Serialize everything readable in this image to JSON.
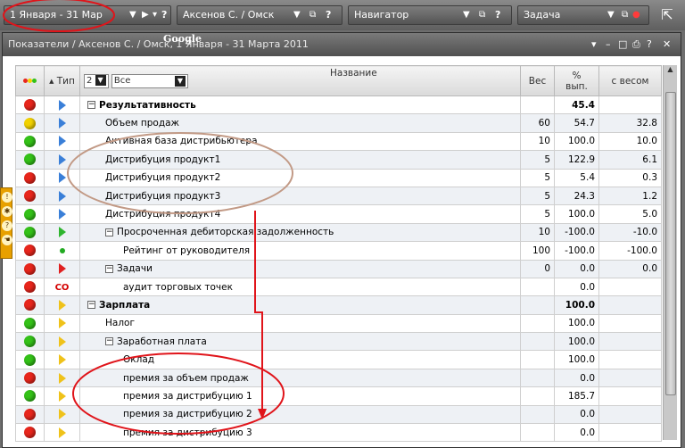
{
  "toolbar": {
    "period": "1 Января - 31 Мар",
    "user": "Аксенов С. / Омск",
    "navigator": "Навигатор",
    "task": "Задача"
  },
  "window": {
    "title": "Показатели / Аксенов С. / Омск, 1 Января - 31 Марта 2011",
    "google": "Google"
  },
  "columns": {
    "type": "Тип",
    "filter_num": "2",
    "filter_all": "Все",
    "name": "Название",
    "weight": "Вес",
    "pct_line1": "%",
    "pct_line2": "вып.",
    "weighted": "с весом"
  },
  "rows": [
    {
      "status": "red",
      "type": "tri-blue",
      "indent": 0,
      "expander": "⊟",
      "name": "Результативность",
      "bold": true,
      "weight": "",
      "pct": "45.4",
      "weighted": ""
    },
    {
      "status": "yellow",
      "type": "tri-blue",
      "indent": 1,
      "expander": "",
      "name": "Объем продаж",
      "bold": false,
      "weight": "60",
      "pct": "54.7",
      "weighted": "32.8"
    },
    {
      "status": "green",
      "type": "tri-blue",
      "indent": 1,
      "expander": "",
      "name": "Активная база дистрибьютера",
      "bold": false,
      "weight": "10",
      "pct": "100.0",
      "weighted": "10.0"
    },
    {
      "status": "green",
      "type": "tri-blue",
      "indent": 1,
      "expander": "",
      "name": "Дистрибуция продукт1",
      "bold": false,
      "weight": "5",
      "pct": "122.9",
      "weighted": "6.1"
    },
    {
      "status": "red",
      "type": "tri-blue",
      "indent": 1,
      "expander": "",
      "name": "Дистрибуция продукт2",
      "bold": false,
      "weight": "5",
      "pct": "5.4",
      "weighted": "0.3"
    },
    {
      "status": "red",
      "type": "tri-blue",
      "indent": 1,
      "expander": "",
      "name": "Дистрибуция продукт3",
      "bold": false,
      "weight": "5",
      "pct": "24.3",
      "weighted": "1.2"
    },
    {
      "status": "green",
      "type": "tri-blue",
      "indent": 1,
      "expander": "",
      "name": "Дистрибуция продукт4",
      "bold": false,
      "weight": "5",
      "pct": "100.0",
      "weighted": "5.0"
    },
    {
      "status": "green",
      "type": "tri-green",
      "indent": 1,
      "expander": "⊟",
      "name": "Просроченная дебиторская задолженность",
      "bold": false,
      "weight": "10",
      "pct": "-100.0",
      "weighted": "-10.0"
    },
    {
      "status": "red",
      "type": "dot-green",
      "indent": 2,
      "expander": "",
      "name": "Рейтинг от руководителя",
      "bold": false,
      "weight": "100",
      "pct": "-100.0",
      "weighted": "-100.0"
    },
    {
      "status": "red",
      "type": "tri-red",
      "indent": 1,
      "expander": "⊟",
      "name": "Задачи",
      "bold": false,
      "weight": "0",
      "pct": "0.0",
      "weighted": "0.0"
    },
    {
      "status": "red",
      "type": "co",
      "indent": 2,
      "expander": "",
      "name": "аудит торговых точек",
      "bold": false,
      "weight": "",
      "pct": "0.0",
      "weighted": ""
    },
    {
      "status": "red",
      "type": "tri-yellow",
      "indent": 0,
      "expander": "⊟",
      "name": "Зарплата",
      "bold": true,
      "weight": "",
      "pct": "100.0",
      "weighted": ""
    },
    {
      "status": "green",
      "type": "tri-yellow",
      "indent": 1,
      "expander": "",
      "name": "Налог",
      "bold": false,
      "weight": "",
      "pct": "100.0",
      "weighted": ""
    },
    {
      "status": "green",
      "type": "tri-yellow",
      "indent": 1,
      "expander": "⊟",
      "name": "Заработная плата",
      "bold": false,
      "weight": "",
      "pct": "100.0",
      "weighted": ""
    },
    {
      "status": "green",
      "type": "tri-yellow",
      "indent": 2,
      "expander": "",
      "name": "Оклад",
      "bold": false,
      "weight": "",
      "pct": "100.0",
      "weighted": ""
    },
    {
      "status": "red",
      "type": "tri-yellow",
      "indent": 2,
      "expander": "",
      "name": "премия за объем продаж",
      "bold": false,
      "weight": "",
      "pct": "0.0",
      "weighted": ""
    },
    {
      "status": "green",
      "type": "tri-yellow",
      "indent": 2,
      "expander": "",
      "name": "премия за дистрибуцию 1",
      "bold": false,
      "weight": "",
      "pct": "185.7",
      "weighted": ""
    },
    {
      "status": "red",
      "type": "tri-yellow",
      "indent": 2,
      "expander": "",
      "name": "премия за дистрибуцию 2",
      "bold": false,
      "weight": "",
      "pct": "0.0",
      "weighted": ""
    },
    {
      "status": "red",
      "type": "tri-yellow",
      "indent": 2,
      "expander": "",
      "name": "премия за дистрибуцию 3",
      "bold": false,
      "weight": "",
      "pct": "0.0",
      "weighted": ""
    }
  ],
  "colors": {
    "red": "#e8261c",
    "yellow": "#f2d200",
    "green": "#34c218",
    "annotation_red": "#e0141a",
    "annotation_tan": "#c29a86"
  }
}
